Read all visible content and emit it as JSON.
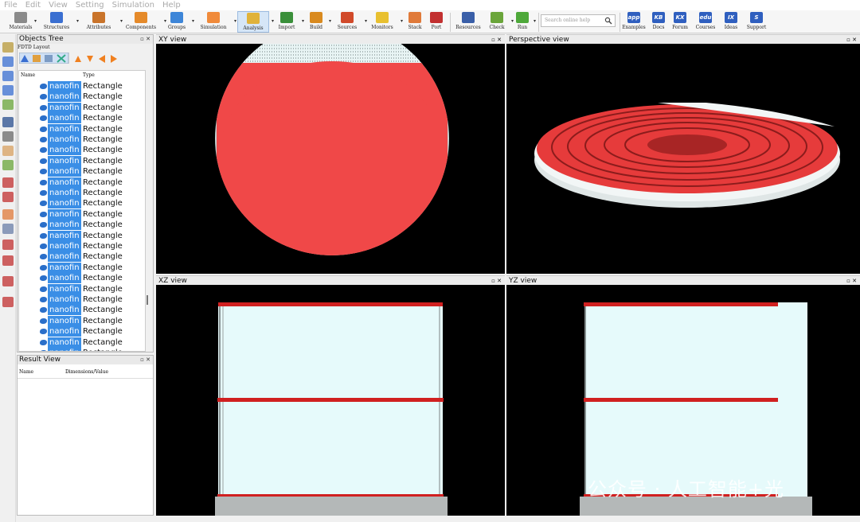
{
  "menu": [
    "File",
    "Edit",
    "View",
    "Setting",
    "Simulation",
    "Help"
  ],
  "toolbar": {
    "items": [
      {
        "label": "Materials",
        "icon": "materials-icon",
        "color": "#8a8a8a"
      },
      {
        "label": "Structures",
        "icon": "structures-icon",
        "color": "#3a6fd1"
      },
      {
        "label": "Attributes",
        "icon": "attributes-icon",
        "color": "#c9742b"
      },
      {
        "label": "Components",
        "icon": "components-icon",
        "color": "#e58a2a"
      },
      {
        "label": "Groups",
        "icon": "groups-icon",
        "color": "#3e86d8"
      },
      {
        "label": "Simulation",
        "icon": "simulation-icon",
        "color": "#f08a3a"
      },
      {
        "label": "Analysis",
        "icon": "analysis-icon",
        "color": "#e0b23a"
      },
      {
        "label": "Import",
        "icon": "import-icon",
        "color": "#3a8f3a"
      },
      {
        "label": "Build",
        "icon": "build-icon",
        "color": "#d98a1f"
      },
      {
        "label": "Sources",
        "icon": "sources-icon",
        "color": "#d14a2a"
      },
      {
        "label": "Monitors",
        "icon": "monitors-icon",
        "color": "#e8c030"
      },
      {
        "label": "Stack",
        "icon": "stack-icon",
        "color": "#e07a3a"
      },
      {
        "label": "Port",
        "icon": "port-icon",
        "color": "#c23030"
      },
      {
        "label": "Resources",
        "icon": "resources-icon",
        "color": "#3a5fa8"
      },
      {
        "label": "Check",
        "icon": "check-icon",
        "color": "#6aa53a"
      },
      {
        "label": "Run",
        "icon": "run-icon",
        "color": "#4ea83a"
      },
      {
        "label": "Examples",
        "icon": "examples-icon",
        "color": "#2f5fbf",
        "text": "app"
      },
      {
        "label": "Docs",
        "icon": "docs-icon",
        "color": "#2f5fbf",
        "text": "KB"
      },
      {
        "label": "Forum",
        "icon": "forum-icon",
        "color": "#2f5fbf",
        "text": "KX"
      },
      {
        "label": "Courses",
        "icon": "courses-icon",
        "color": "#2f5fbf",
        "text": "edu"
      },
      {
        "label": "Ideas",
        "icon": "ideas-icon",
        "color": "#2f5fbf",
        "text": "IX"
      },
      {
        "label": "Support",
        "icon": "support-icon",
        "color": "#2f5fbf",
        "text": "S"
      }
    ],
    "search_placeholder": "Search online help"
  },
  "objects_tree": {
    "title": "Objects Tree",
    "layout_label": "FDTD Layout",
    "col_name": "Name",
    "col_type": "Type",
    "row_name": "nanofin",
    "row_type": "Rectangle",
    "row_count": 26
  },
  "result_view": {
    "title": "Result View",
    "col_name": "Name",
    "col_value": "Dimensions/Value"
  },
  "views": {
    "xy": "XY view",
    "perspective": "Perspective view",
    "xz": "XZ view",
    "yz": "YZ view"
  },
  "colors": {
    "nanofin": "#f04848",
    "substrate": "#e6fafb",
    "pedestal": "#b4b8b8",
    "viewport_bg": "#000000",
    "selection": "#3a8ee6"
  },
  "watermark": "公众号 · 人工智能+光"
}
